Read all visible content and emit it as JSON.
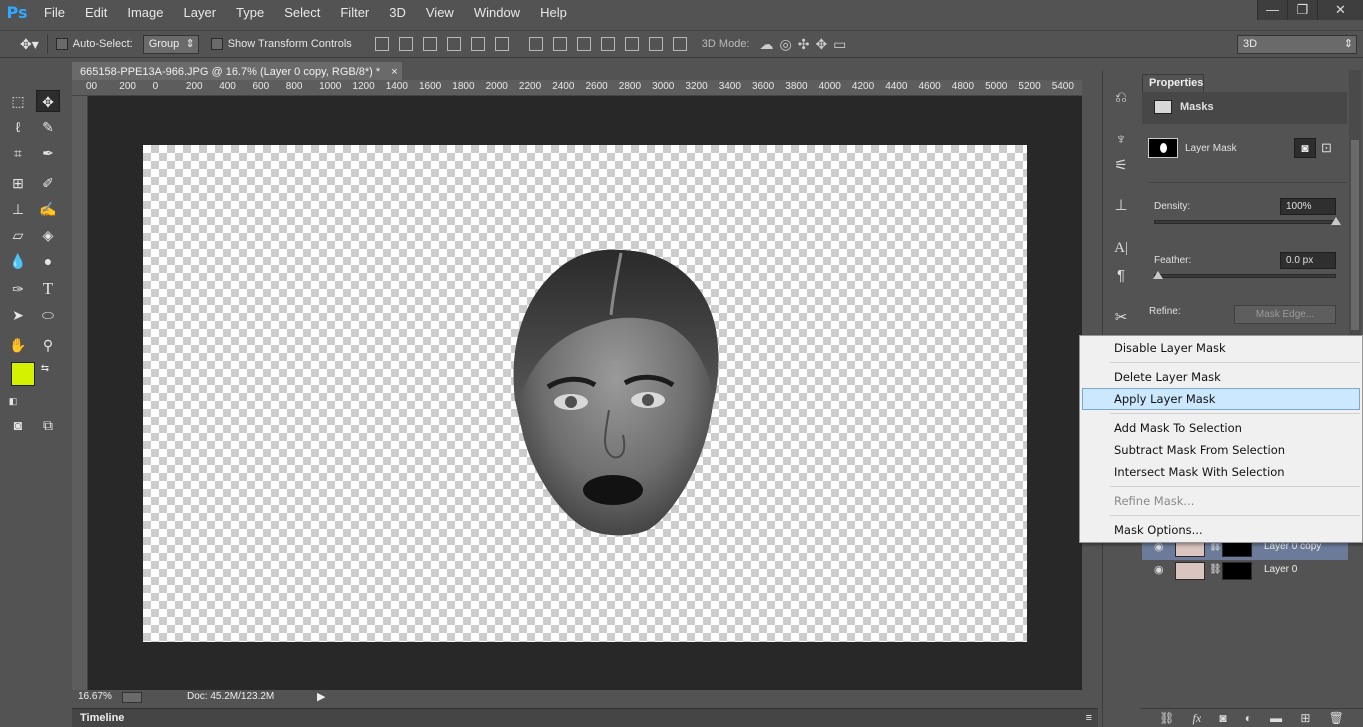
{
  "app": {
    "logo": "Ps"
  },
  "menubar": {
    "items": [
      "File",
      "Edit",
      "Image",
      "Layer",
      "Type",
      "Select",
      "Filter",
      "3D",
      "View",
      "Window",
      "Help"
    ]
  },
  "window_controls": {
    "minimize": "—",
    "restore": "❐",
    "close": "✕"
  },
  "options_bar": {
    "auto_select_label": "Auto-Select:",
    "auto_select_value": "Group",
    "show_transform_label": "Show Transform Controls",
    "mode_3d_label": "3D Mode:",
    "workspace_value": "3D"
  },
  "document": {
    "tab_title": "665158-PPE13A-966.JPG @ 16.7% (Layer 0 copy, RGB/8*) *",
    "ruler_ticks": [
      "00",
      "200",
      "0",
      "200",
      "400",
      "600",
      "800",
      "1000",
      "1200",
      "1400",
      "1600",
      "1800",
      "2000",
      "2200",
      "2400",
      "2600",
      "2800",
      "3000",
      "3200",
      "3400",
      "3600",
      "3800",
      "4000",
      "4200",
      "4400",
      "4600",
      "4800",
      "5000",
      "5200",
      "5400"
    ]
  },
  "status_bar": {
    "zoom": "16.67%",
    "doc_info": "Doc: 45.2M/123.2M"
  },
  "timeline": {
    "label": "Timeline"
  },
  "colors": {
    "foreground": "#d4f200",
    "background": "#e0a898",
    "context_highlight": "#cce8ff"
  },
  "properties": {
    "tab_label": "Properties",
    "section_title": "Masks",
    "layer_mask_label": "Layer Mask",
    "density_label": "Density:",
    "density_value": "100%",
    "density_level": 1.0,
    "feather_label": "Feather:",
    "feather_value": "0.0 px",
    "feather_level": 0.0,
    "refine_label": "Refine:",
    "mask_edge_button": "Mask Edge..."
  },
  "layers": {
    "rows": [
      {
        "name": "Layer 0 copy",
        "selected": true
      },
      {
        "name": "Layer 0",
        "selected": false
      }
    ]
  },
  "context_menu": {
    "items": [
      {
        "label": "Disable Layer Mask",
        "enabled": true
      },
      {
        "label": "Delete Layer Mask",
        "enabled": true
      },
      {
        "label": "Apply Layer Mask",
        "enabled": true,
        "highlighted": true
      },
      {
        "label": "Add Mask To Selection",
        "enabled": true
      },
      {
        "label": "Subtract Mask From Selection",
        "enabled": true
      },
      {
        "label": "Intersect Mask With Selection",
        "enabled": true
      },
      {
        "label": "Refine Mask...",
        "enabled": false
      },
      {
        "label": "Mask Options...",
        "enabled": true
      }
    ]
  }
}
